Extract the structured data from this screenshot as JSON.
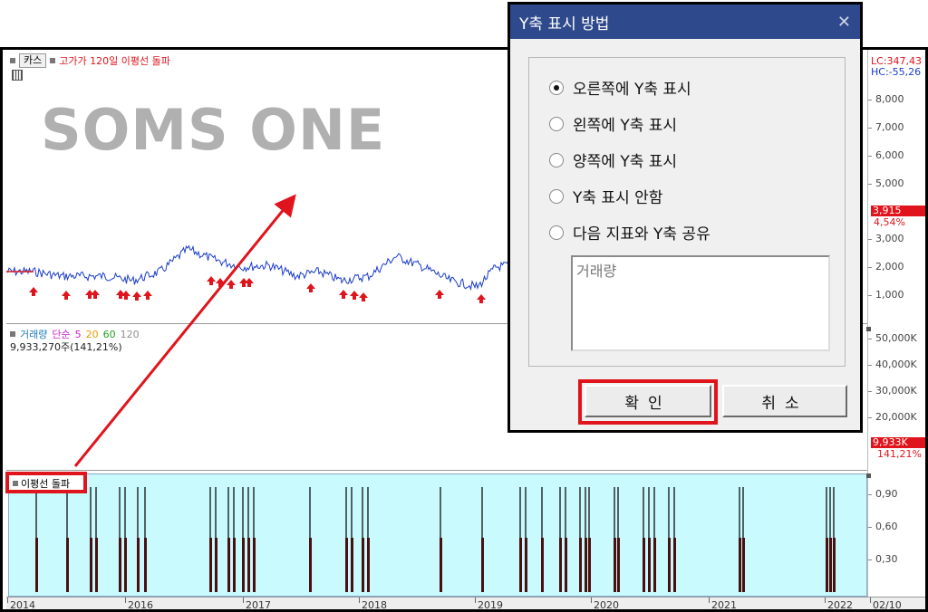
{
  "chart_header": {
    "type_button": "카스",
    "indicator_title": "고가가 120일 이평선 돌파"
  },
  "watermark": "SOMS ONE",
  "price_axis": {
    "lc_label": "LC:347,43",
    "hc_label": "HC:-55,26",
    "ticks": [
      "8,000",
      "7,000",
      "6,000",
      "5,000",
      "3,000",
      "2,000",
      "1,000"
    ],
    "current_value": "3,915",
    "current_pct": "4,54%"
  },
  "volume": {
    "title": "거래량",
    "ma_label": "단순",
    "ma_periods": [
      "5",
      "20",
      "60",
      "120"
    ],
    "ma_colors": [
      "#d020d0",
      "#e0a000",
      "#20a020",
      "#909090"
    ],
    "current_text": "9,933,270주(141,21%)",
    "axis_ticks": [
      "50,000K",
      "40,000K",
      "30,000K",
      "20,000K"
    ],
    "current_value": "9,933K",
    "current_pct": "141,21%"
  },
  "signal": {
    "title": "이평선 돌파",
    "axis_ticks": [
      "0,90",
      "0,60",
      "0,30"
    ]
  },
  "x_axis": {
    "labels": [
      "2014",
      "2016",
      "2017",
      "2018",
      "2019",
      "2020",
      "2021",
      "2022"
    ],
    "last_date": "02/10"
  },
  "dialog": {
    "title": "Y축 표시 방법",
    "close_glyph": "✕",
    "options": [
      {
        "label": "오른쪽에 Y축 표시",
        "selected": true
      },
      {
        "label": "왼쪽에 Y축 표시",
        "selected": false
      },
      {
        "label": "양쪽에 Y축 표시",
        "selected": false
      },
      {
        "label": "Y축 표시 안함",
        "selected": false
      },
      {
        "label": "다음 지표와 Y축 공유",
        "selected": false
      }
    ],
    "share_list_item": "거래량",
    "ok_label": "확인",
    "cancel_label": "취소"
  },
  "colors": {
    "highlight": "#e0141c",
    "dialog_title_bg": "#2f4a8c",
    "signal_bg": "#c8fafe",
    "price_line": "#1a3cc8",
    "price_up": "#e0141c"
  }
}
